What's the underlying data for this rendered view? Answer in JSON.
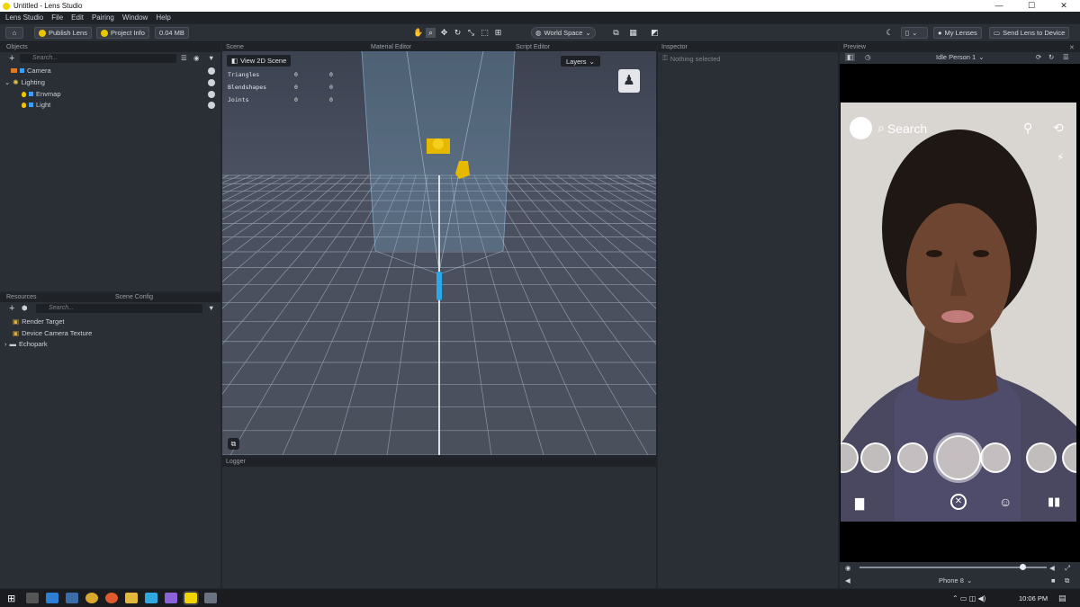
{
  "window": {
    "title": "Untitled - Lens Studio",
    "controls": [
      "—",
      "☐",
      "✕"
    ]
  },
  "menu": [
    "Lens Studio",
    "File",
    "Edit",
    "Pairing",
    "Window",
    "Help"
  ],
  "toolbar": {
    "publish": "Publish Lens",
    "project_info": "Project Info",
    "size": "0.04 MB",
    "space": "World Space",
    "my_lenses": "My Lenses",
    "send": "Send Lens to Device"
  },
  "objects": {
    "title": "Objects",
    "search_placeholder": "Search...",
    "items": [
      {
        "label": "Camera",
        "indent": 0
      },
      {
        "label": "Lighting",
        "indent": 0
      },
      {
        "label": "Envmap",
        "indent": 1
      },
      {
        "label": "Light",
        "indent": 1
      }
    ]
  },
  "resources": {
    "title": "Resources",
    "tab2": "Scene Config",
    "search_placeholder": "Search...",
    "items": [
      "Render Target",
      "Device Camera Texture",
      "Echopark"
    ]
  },
  "scene": {
    "tabs": [
      "Scene",
      "Material Editor",
      "Script Editor"
    ],
    "view2d": "View 2D Scene",
    "layers": "Layers",
    "stats": [
      {
        "name": "Triangles",
        "a": "0",
        "b": "0"
      },
      {
        "name": "Blendshapes",
        "a": "0",
        "b": "0"
      },
      {
        "name": "Joints",
        "a": "0",
        "b": "0"
      }
    ]
  },
  "inspector": {
    "title": "Inspector",
    "empty": "Nothing selected"
  },
  "logger": {
    "title": "Logger"
  },
  "preview": {
    "title": "Preview",
    "person": "Idle Person 1",
    "search": "Search",
    "device": "Phone 8",
    "progress": 0.87
  },
  "taskbar": {
    "time": "10:06 PM"
  },
  "colors": {
    "accent": "#f2c400",
    "blue": "#3aa0ff",
    "sceneBg": "#444a57"
  }
}
